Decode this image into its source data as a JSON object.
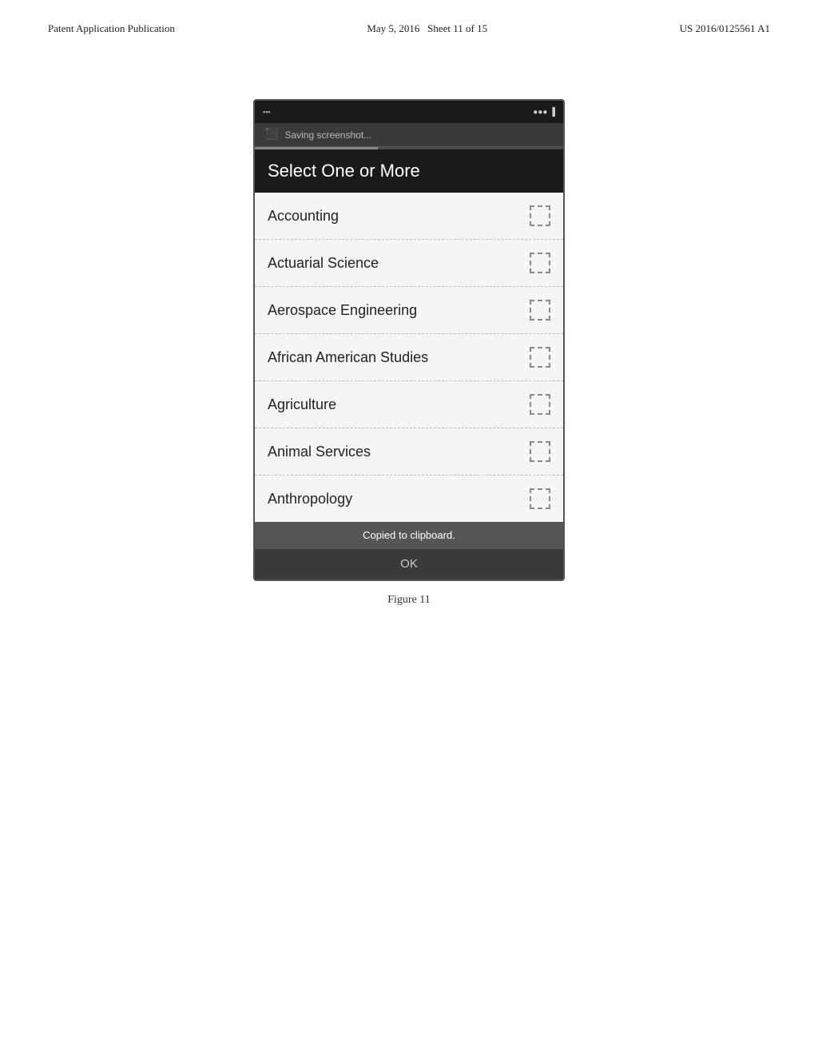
{
  "patent": {
    "left_label": "Patent Application Publication",
    "center_label": "May 5, 2016",
    "sheet_label": "Sheet 11 of 15",
    "right_label": "US 2016/0125561 A1"
  },
  "status_bar": {
    "left_icons": "▪ ▪ ▪",
    "right_text": "▪▪▪ ●●●"
  },
  "screenshot_bar": {
    "icon": "⬛",
    "text": "Saving screenshot..."
  },
  "app_header": {
    "title": "Select One or More"
  },
  "list_items": [
    {
      "label": "Accounting"
    },
    {
      "label": "Actuarial Science"
    },
    {
      "label": "Aerospace Engineering"
    },
    {
      "label": "African American Studies"
    },
    {
      "label": "Agriculture"
    },
    {
      "label": "Animal Services"
    },
    {
      "label": "Anthropology"
    }
  ],
  "toast": {
    "text": "Copied to clipboard."
  },
  "ok_button": {
    "label": "OK"
  },
  "figure": {
    "label": "Figure 11"
  }
}
